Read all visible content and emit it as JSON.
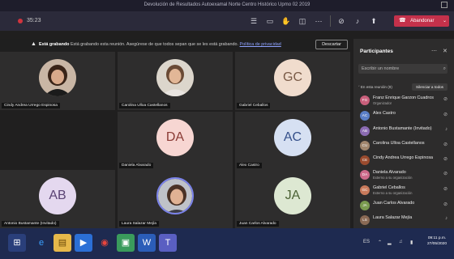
{
  "window": {
    "title": "Devolución de Resultados Autoexamal Norte Centro Histórico Upmo 02 2019"
  },
  "toolbar": {
    "timer": "35:23",
    "leave_label": "Abandonar",
    "leave_icon": "phone-hangup-icon"
  },
  "banner": {
    "bold": "Está grabando",
    "text": " Está grabando esta reunión. Asegúrese de que todos sepan que se les está grabando. ",
    "link": "Política de privacidad",
    "discard": "Descartar"
  },
  "tiles": [
    {
      "name": "Cindy Andrea Urrego Espinosa",
      "type": "photo"
    },
    {
      "name": "Carolina Ulloa Castellanos",
      "type": "photo"
    },
    {
      "name": "Gabriel Ceballos",
      "initials": "GC",
      "color": "#f0dccd",
      "text": "#7a5b47"
    },
    {
      "name": "Daniela Alvarado",
      "initials": "DA",
      "color": "#f7d6d2",
      "text": "#8a3b35"
    },
    {
      "name": "Alex Castro",
      "initials": "AC",
      "color": "#d6e0f2",
      "text": "#35508a"
    },
    {
      "name": "Antonio Bustamante (Invitado)",
      "initials": "AB",
      "color": "#e4d8ef",
      "text": "#5a4374"
    },
    {
      "name": "Laura Salazar Mejía",
      "type": "photo"
    },
    {
      "name": "Juan Carlos Alvarado",
      "initials": "JA",
      "color": "#dde8d2",
      "text": "#4b6235"
    }
  ],
  "panel": {
    "title": "Participantes",
    "search_placeholder": "Escribir un nombre",
    "section": "En esta reunión (9)",
    "mute_all": "Silenciar a todos",
    "people": [
      {
        "name": "Franz Enrique Garzon Cuadros",
        "sub": "Organizador",
        "initials": "FG",
        "color": "#c95f7b"
      },
      {
        "name": "Alex Castro",
        "sub": "",
        "initials": "AC",
        "color": "#5b7fc7"
      },
      {
        "name": "Antonio Bustamante (Invitado)",
        "sub": "",
        "initials": "AB",
        "color": "#8b6bb3"
      },
      {
        "name": "Carolina Ulloa Castellanos",
        "sub": "",
        "initials": "CU",
        "color": "#a0856d"
      },
      {
        "name": "Cindy Andrea Urrego Espinosa",
        "sub": "",
        "initials": "CE",
        "color": "#9a4b2e"
      },
      {
        "name": "Daniela Alvarado",
        "sub": "Externo a su organización",
        "initials": "DA",
        "color": "#cc6a8a"
      },
      {
        "name": "Gabriel Ceballos",
        "sub": "Externo a su organización",
        "initials": "GC",
        "color": "#c97a5b"
      },
      {
        "name": "Juan Carlos Alvarado",
        "sub": "",
        "initials": "JA",
        "color": "#7a9b4f"
      },
      {
        "name": "Laura Salazar Mejía",
        "sub": "",
        "initials": "LS",
        "color": "#8a6a55"
      }
    ]
  },
  "taskbar": {
    "time": "09:11 p.m.",
    "date": "27/05/2020",
    "lang": "ES"
  }
}
